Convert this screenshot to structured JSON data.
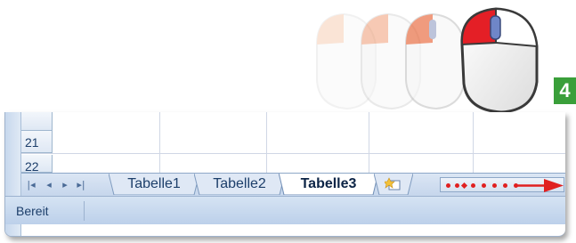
{
  "step": {
    "number": "4"
  },
  "grid": {
    "rows": [
      "21",
      "22"
    ]
  },
  "sheet_tabs": {
    "nav_icons": [
      "first-sheet-icon",
      "prev-sheet-icon",
      "next-sheet-icon",
      "last-sheet-icon"
    ],
    "tabs": [
      {
        "label": "Tabelle1",
        "active": false
      },
      {
        "label": "Tabelle2",
        "active": false
      },
      {
        "label": "Tabelle3",
        "active": true
      }
    ],
    "insert_icon": "insert-worksheet-icon"
  },
  "status_bar": {
    "text": "Bereit"
  },
  "colors": {
    "mouse_button_red": "#e02020",
    "step_badge_green": "#3a9f3a",
    "annotation_arrow_red": "#e02020"
  }
}
